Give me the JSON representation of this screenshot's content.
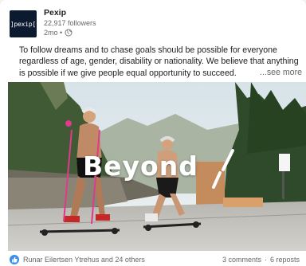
{
  "post": {
    "company_name": "Pexip",
    "logo_text": "]pexip[",
    "followers": "22,917 followers",
    "time": "2mo",
    "visibility_icon": "globe-icon",
    "text": "To follow dreams and to chase goals should be possible for everyone regardless of age, gender, disability or nationality. We believe that anything is possible if we give people equal opportunity to succeed.",
    "see_more": "...see more",
    "image_overlay_text": "Beyond"
  },
  "social": {
    "reaction_icon": "like-icon",
    "reactors": "Runar Eilertsen Ytrehus and 24 others",
    "comments": "3 comments",
    "separator": "·",
    "reposts": "6 reposts"
  },
  "colors": {
    "logo_bg": "#0b1a2f",
    "like_blue": "#378fe9",
    "muted_text": "#666666"
  }
}
